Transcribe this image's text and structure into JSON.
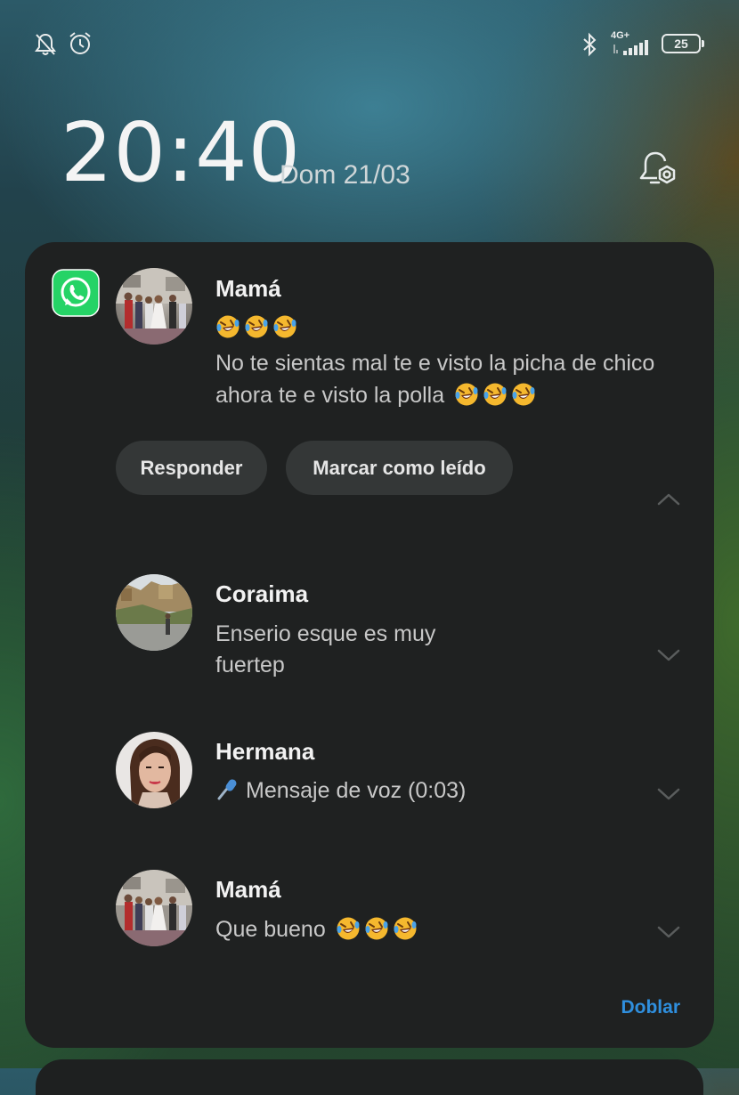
{
  "status_bar": {
    "network_label": "4G+",
    "battery_level": "25",
    "icons": [
      "bell-muted-icon",
      "alarm-clock-icon",
      "bluetooth-icon",
      "signal-icon",
      "battery-icon"
    ]
  },
  "lockscreen": {
    "time": "20:40",
    "date": "Dom 21/03"
  },
  "notification": {
    "app_icon": "whatsapp-icon",
    "primary": {
      "sender": "Mamá",
      "line1_emojis": 3,
      "line2": "No te sientas mal te e visto la picha de chico",
      "line3": "ahora te e visto la polla",
      "line3_emojis": 3
    },
    "actions": {
      "reply_label": "Responder",
      "mark_read_label": "Marcar como leído"
    },
    "messages": [
      {
        "sender": "Coraima",
        "line1": "Enserio esque es muy",
        "line2": "fuertep"
      },
      {
        "sender": "Hermana",
        "text": "Mensaje de voz (0:03)",
        "icon": "microphone-icon"
      },
      {
        "sender": "Mamá",
        "text": "Que bueno",
        "emojis": 3
      }
    ],
    "collapse_label": "Doblar"
  },
  "colors": {
    "card_bg": "#1f2121",
    "chip_bg": "#343737",
    "accent": "#2f8fde",
    "whatsapp_green": "#25d366"
  }
}
